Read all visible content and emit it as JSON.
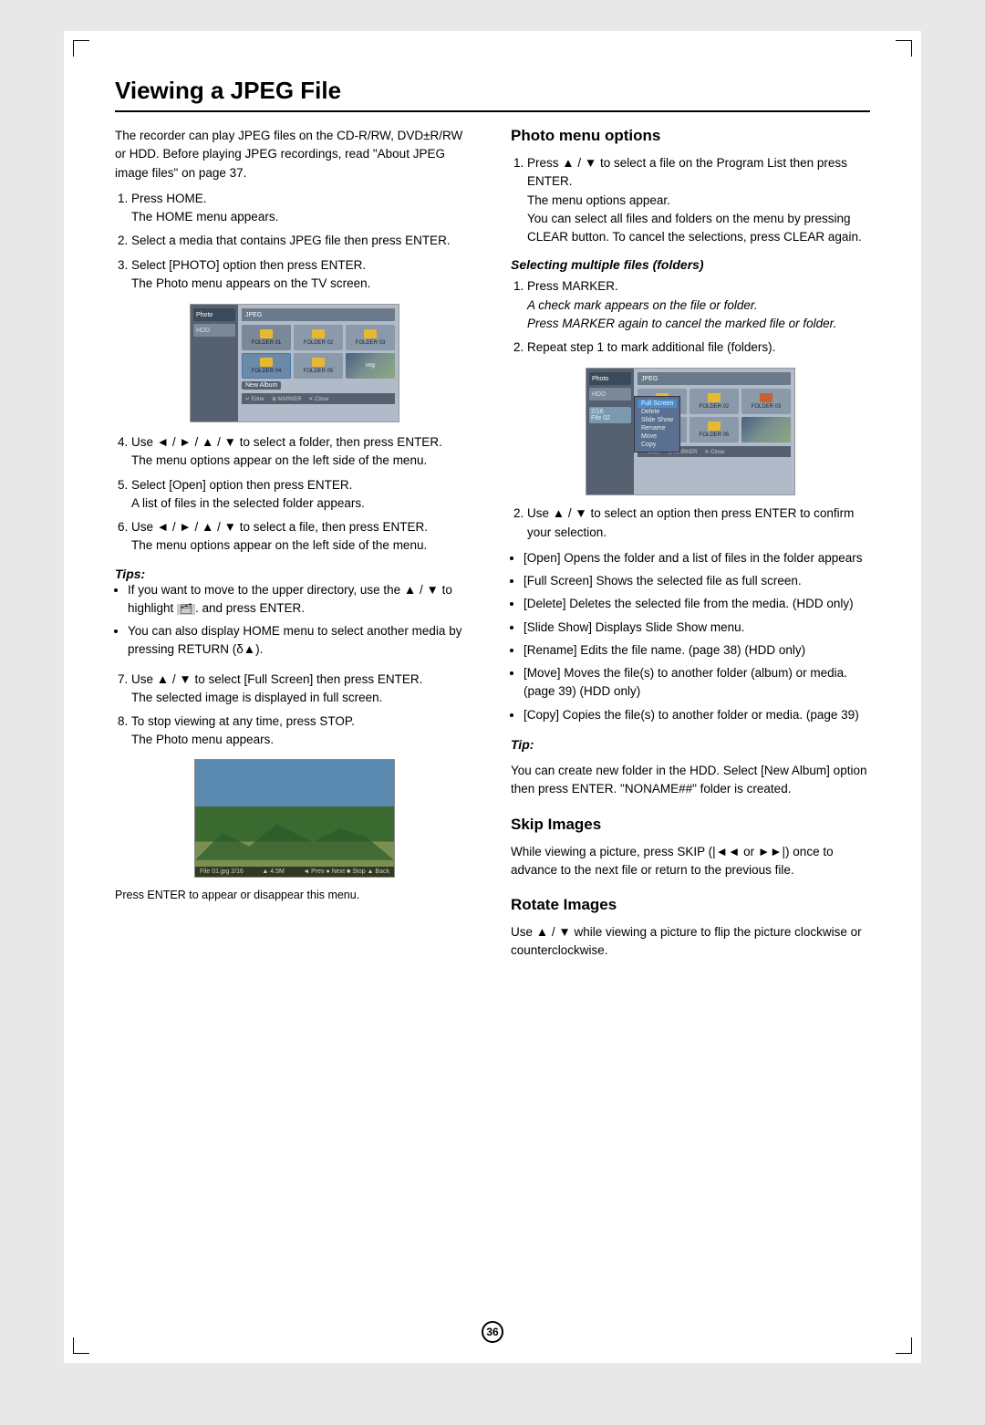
{
  "page": {
    "title": "Viewing a JPEG File",
    "number": "36"
  },
  "left_col": {
    "intro": "The recorder can play JPEG files on the CD-R/RW, DVD±R/RW or HDD. Before playing JPEG recordings, read \"About JPEG image files\" on page 37.",
    "steps": [
      {
        "num": "1",
        "main": "Press HOME.",
        "sub": "The HOME menu appears."
      },
      {
        "num": "2",
        "main": "Select a media that contains JPEG file then press ENTER."
      },
      {
        "num": "3",
        "main": "Select [PHOTO] option then press ENTER.",
        "sub": "The Photo menu appears on the TV screen."
      },
      {
        "num": "4",
        "main": "Use ◄ / ► / ▲ / ▼ to select a folder, then press ENTER.",
        "sub": "The menu options appear on the left side of the menu."
      },
      {
        "num": "5",
        "main": "Select [Open] option then press ENTER.",
        "sub": "A list of files in the selected folder appears."
      },
      {
        "num": "6",
        "main": "Use ◄ / ► / ▲ / ▼ to select a file, then press ENTER.",
        "sub": "The menu options appear on the left side of the menu."
      }
    ],
    "tips_label": "Tips:",
    "tips": [
      "If you want to move to the upper directory, use the ▲ / ▼ to highlight  and press ENTER.",
      "You can also display HOME menu to select another media by pressing RETURN (δ)."
    ],
    "steps2": [
      {
        "num": "7",
        "main": "Use ▲ / ▼ to select [Full Screen] then press ENTER.",
        "sub": "The selected image is displayed in full screen."
      },
      {
        "num": "8",
        "main": "To stop viewing at any time, press STOP.",
        "sub": "The Photo menu appears."
      }
    ],
    "caption": "Press ENTER to appear or disappear this menu.",
    "photo_info": {
      "filename": "File 01.jpg",
      "size": "2/16",
      "dimensions": "4.5M",
      "controls": "◄ Prev  ● Next  ■ Stop  ▲ Back"
    }
  },
  "right_col": {
    "photo_menu_title": "Photo menu options",
    "step1": {
      "main": "Press ▲ / ▼ to select a file on the Program List then press ENTER.",
      "sub1": "The menu options appear.",
      "sub2": "You can select all files and folders on the menu by pressing CLEAR button. To cancel the selections, press CLEAR again."
    },
    "selecting_title": "Selecting multiple files (folders)",
    "selecting_steps": [
      {
        "num": "1",
        "main": "Press MARKER.",
        "sub1": "A check mark appears on the file or folder.",
        "sub2": "Press MARKER again to cancel the marked file or folder."
      },
      {
        "num": "2",
        "main": "Repeat step 1 to mark additional file (folders)."
      }
    ],
    "step2": {
      "main": "Use ▲ / ▼ to select an option then press ENTER to confirm your selection."
    },
    "options": [
      "[Open] Opens the folder and a list of files in the folder appears",
      "[Full Screen] Shows the selected file as full screen.",
      "[Delete] Deletes the selected file from the media. (HDD only)",
      "[Slide Show] Displays Slide Show menu.",
      "[Rename] Edits the file name. (page 38) (HDD only)",
      "[Move] Moves the file(s) to another folder (album) or media. (page 39) (HDD only)",
      "[Copy] Copies the file(s) to another folder or media. (page 39)"
    ],
    "tip_label": "Tip:",
    "tip_text": "You can create new folder in the HDD. Select [New Album] option then press ENTER. \"NONAME##\" folder is created.",
    "skip_title": "Skip Images",
    "skip_text": "While viewing a picture, press SKIP (|◄◄ or ►►|) once to advance to the next file or return to the previous file.",
    "rotate_title": "Rotate Images",
    "rotate_text": "Use ▲ / ▼ while viewing a picture to flip the picture clockwise or counterclockwise."
  }
}
